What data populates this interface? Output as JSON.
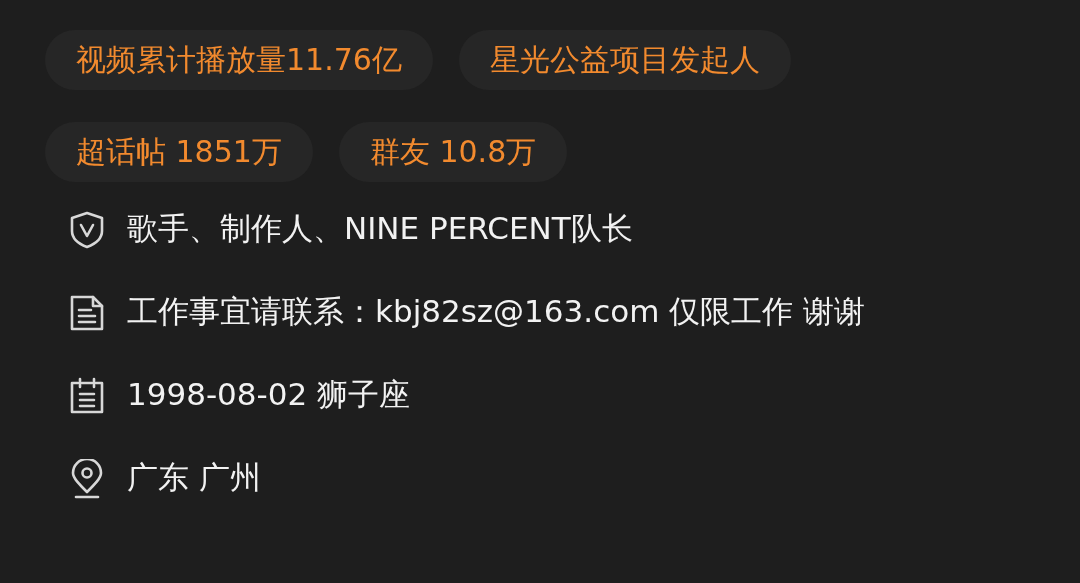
{
  "tags": [
    [
      "视频累计播放量11.76亿",
      "星光公益项目发起人"
    ],
    [
      "超话帖 1851万",
      "群友 10.8万"
    ]
  ],
  "info": [
    {
      "kind": "verified",
      "text": "歌手、制作人、NINE PERCENT队长"
    },
    {
      "kind": "document",
      "text": "工作事宜请联系：kbj82sz@163.com 仅限工作 谢谢"
    },
    {
      "kind": "calendar",
      "text": "1998-08-02 狮子座"
    },
    {
      "kind": "location",
      "text": "广东 广州"
    }
  ]
}
